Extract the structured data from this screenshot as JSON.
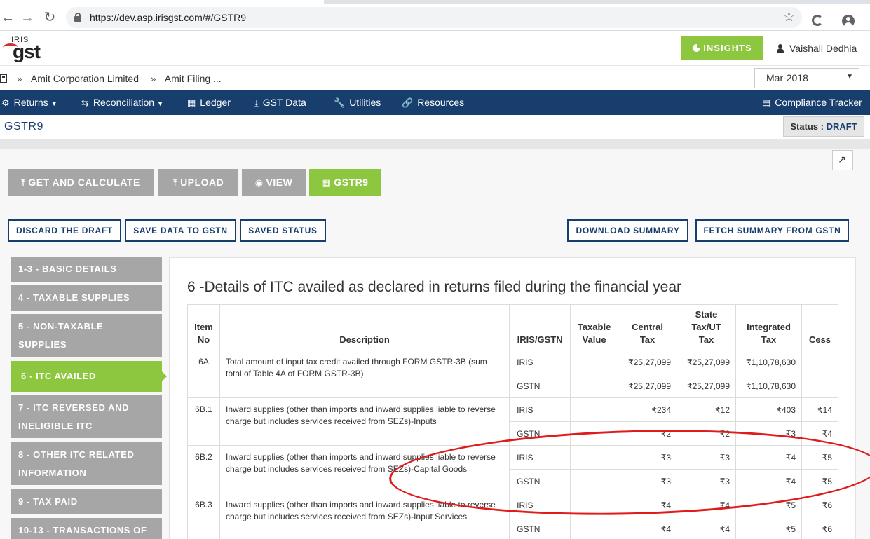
{
  "browser": {
    "url": "https://dev.asp.irisgst.com/#/GSTR9"
  },
  "header": {
    "logo_top": "IRIS",
    "logo_main": "gst",
    "insights_label": "INSIGHTS",
    "user_name": "Vaishali Dedhia"
  },
  "breadcrumb": {
    "items": [
      "Amit Corporation Limited",
      "Amit Filing ..."
    ],
    "period": "Mar-2018"
  },
  "nav": {
    "items": [
      "Returns",
      "Reconciliation",
      "Ledger",
      "GST Data",
      "Utilities",
      "Resources"
    ],
    "right_item": "Compliance Tracker"
  },
  "page": {
    "title": "GSTR9",
    "status_label": "Status :",
    "status_value": "DRAFT"
  },
  "actions": {
    "primary": [
      "GET AND CALCULATE",
      "UPLOAD",
      "VIEW",
      "GSTR9"
    ],
    "secondary": [
      "DISCARD THE DRAFT",
      "SAVE DATA TO GSTN",
      "SAVED STATUS",
      "DOWNLOAD SUMMARY",
      "FETCH SUMMARY FROM GSTN"
    ]
  },
  "sidebar": {
    "items": [
      [
        "1-3 - BASIC DETAILS"
      ],
      [
        "4 - TAXABLE SUPPLIES"
      ],
      [
        "5 - NON-TAXABLE",
        "SUPPLIES"
      ],
      [
        "6 - ITC AVAILED"
      ],
      [
        "7 - ITC REVERSED AND",
        "INELIGIBLE ITC"
      ],
      [
        "8 - OTHER ITC RELATED",
        "INFORMATION"
      ],
      [
        "9 - TAX PAID"
      ],
      [
        "10-13 - TRANSACTIONS OF"
      ]
    ]
  },
  "section": {
    "title": "6 -Details of ITC availed as declared in returns filed during the financial year",
    "headers": {
      "item_no": [
        "Item",
        "No"
      ],
      "description": "Description",
      "source": "IRIS/GSTN",
      "taxable": [
        "Taxable",
        "Value"
      ],
      "central": [
        "Central",
        "Tax"
      ],
      "state": [
        "State",
        "Tax/UT",
        "Tax"
      ],
      "integrated": [
        "Integrated",
        "Tax"
      ],
      "cess": "Cess"
    },
    "rows": [
      {
        "no": "6A",
        "desc": "Total amount of input tax credit availed through FORM GSTR-3B (sum total of Table 4A of FORM GSTR-3B)",
        "lines": [
          {
            "src": "IRIS",
            "taxable": "",
            "central": "₹25,27,099",
            "state": "₹25,27,099",
            "integrated": "₹1,10,78,630",
            "cess": ""
          },
          {
            "src": "GSTN",
            "taxable": "",
            "central": "₹25,27,099",
            "state": "₹25,27,099",
            "integrated": "₹1,10,78,630",
            "cess": ""
          }
        ]
      },
      {
        "no": "6B.1",
        "desc": "Inward supplies (other than imports and inward supplies liable to reverse charge but includes services received from SEZs)-Inputs",
        "lines": [
          {
            "src": "IRIS",
            "taxable": "",
            "central": "₹234",
            "state": "₹12",
            "integrated": "₹403",
            "cess": "₹14"
          },
          {
            "src": "GSTN",
            "taxable": "",
            "central": "₹2",
            "state": "₹2",
            "integrated": "₹3",
            "cess": "₹4"
          }
        ]
      },
      {
        "no": "6B.2",
        "desc": "Inward supplies (other than imports and inward supplies liable to reverse charge but includes services received from SEZs)-Capital Goods",
        "lines": [
          {
            "src": "IRIS",
            "taxable": "",
            "central": "₹3",
            "state": "₹3",
            "integrated": "₹4",
            "cess": "₹5"
          },
          {
            "src": "GSTN",
            "taxable": "",
            "central": "₹3",
            "state": "₹3",
            "integrated": "₹4",
            "cess": "₹5"
          }
        ]
      },
      {
        "no": "6B.3",
        "desc": "Inward supplies (other than imports and inward supplies liable to reverse charge but includes services received from SEZs)-Input Services",
        "lines": [
          {
            "src": "IRIS",
            "taxable": "",
            "central": "₹4",
            "state": "₹4",
            "integrated": "₹5",
            "cess": "₹6"
          },
          {
            "src": "GSTN",
            "taxable": "",
            "central": "₹4",
            "state": "₹4",
            "integrated": "₹5",
            "cess": "₹6"
          }
        ]
      }
    ]
  },
  "colors": {
    "navy": "#183e6e",
    "green": "#8dc63f",
    "gray": "#a6a6a6",
    "annotation": "#e01b1b"
  }
}
